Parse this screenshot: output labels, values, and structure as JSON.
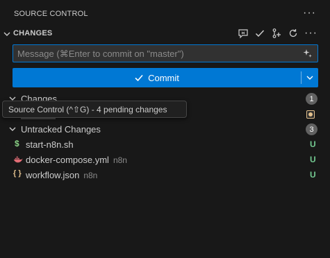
{
  "header": {
    "title": "SOURCE CONTROL",
    "more": "···"
  },
  "section": {
    "title": "CHANGES",
    "actions": [
      {
        "name": "generate-commit-message-icon"
      },
      {
        "name": "commit-check-icon"
      },
      {
        "name": "branch-commit-icon"
      },
      {
        "name": "refresh-icon"
      },
      {
        "name": "more-icon"
      }
    ]
  },
  "commit_input": {
    "placeholder": "Message (⌘Enter to commit on \"master\")",
    "value": ""
  },
  "commit_button": {
    "label": "Commit"
  },
  "groups": [
    {
      "label": "Changes",
      "count": "1"
    },
    {
      "label": "Untracked Changes",
      "count": "3"
    }
  ],
  "tooltip": {
    "text": "Source Control (^⇧G) - 4 pending changes"
  },
  "files": [
    {
      "name": "start-n8n.sh",
      "dir": "",
      "status": "U",
      "icon": "shell-script-icon",
      "icon_glyph": "$",
      "icon_color": "#89d185"
    },
    {
      "name": "docker-compose.yml",
      "dir": "n8n",
      "status": "U",
      "icon": "docker-icon",
      "icon_glyph": "🐳",
      "icon_color": "#e06c75"
    },
    {
      "name": "workflow.json",
      "dir": "n8n",
      "status": "U",
      "icon": "json-icon",
      "icon_glyph": "{ }",
      "icon_color": "#e2c08d"
    }
  ],
  "colors": {
    "accent": "#0078d4",
    "untracked": "#73c991",
    "modified": "#e2c08d"
  }
}
